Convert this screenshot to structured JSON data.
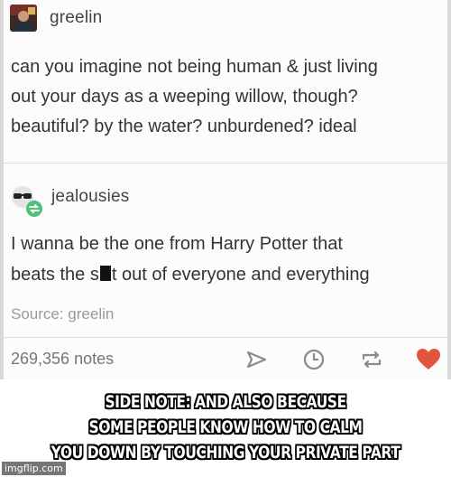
{
  "post": {
    "op": {
      "username": "greelin",
      "text_lines": [
        "can you imagine not being human & just living",
        "out your days as a weeping willow, though?",
        "beautiful? by the water? unburdened? ideal"
      ]
    },
    "reblog": {
      "username": "jealousies",
      "line1": "I wanna be the one from Harry Potter that",
      "line2_before": "beats the s",
      "line2_after": "t out of everyone and everything"
    },
    "source": "Source: greelin",
    "notes": "269,356 notes",
    "icons": [
      "share-icon",
      "clock-icon",
      "reblog-icon",
      "heart-icon"
    ],
    "colors": {
      "heart": "#e0553c",
      "reblog_badge": "#4fbf79",
      "icon_gray": "#8a8a8a"
    }
  },
  "caption": {
    "lines": [
      "SIDE NOTE: AND ALSO BECAUSE",
      "SOME PEOPLE KNOW HOW TO CALM",
      "YOU DOWN BY TOUCHING YOUR PRIVATE PART"
    ]
  },
  "watermark": "imgflip.com"
}
